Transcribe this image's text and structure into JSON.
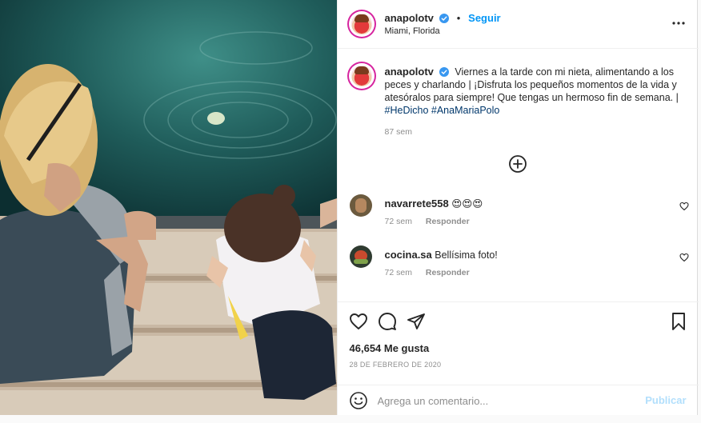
{
  "post": {
    "author": {
      "username": "anapolotv",
      "verified_icon": "verified-badge-icon",
      "follow_label": "Seguir",
      "location": "Miami, Florida",
      "avatar_icon": "profile-avatar"
    },
    "more_icon": "more-options-icon",
    "caption": {
      "username": "anapolotv",
      "text": "Viernes a la tarde con mi nieta, alimentando a los peces y charlando | ¡Disfruta los pequeños momentos de la vida y atesóralos para siempre! Que tengas un hermoso fin de semana. |",
      "hashtags": [
        "#HeDicho",
        "#AnaMariaPolo"
      ],
      "age": "87 sem"
    },
    "load_more_icon": "plus-circle-icon",
    "comments": [
      {
        "username": "navarrete558",
        "text": "😍😍😍",
        "age": "72 sem",
        "reply_label": "Responder"
      },
      {
        "username": "cocina.sa",
        "text": "Bellísima foto!",
        "age": "72 sem",
        "reply_label": "Responder"
      }
    ],
    "actions": {
      "like_icon": "heart-icon",
      "comment_icon": "comment-icon",
      "share_icon": "send-icon",
      "save_icon": "bookmark-icon"
    },
    "likes_text": "46,654 Me gusta",
    "date": "28 DE FEBRERO DE 2020",
    "add_comment": {
      "placeholder": "Agrega un comentario...",
      "publish_label": "Publicar",
      "emoji_icon": "emoji-icon"
    },
    "colors": {
      "accent": "#0095f6",
      "publish_disabled": "#b2dffc",
      "hashtag": "#00376b",
      "muted": "#8e8e8e",
      "water": "#1d5a5a"
    }
  }
}
